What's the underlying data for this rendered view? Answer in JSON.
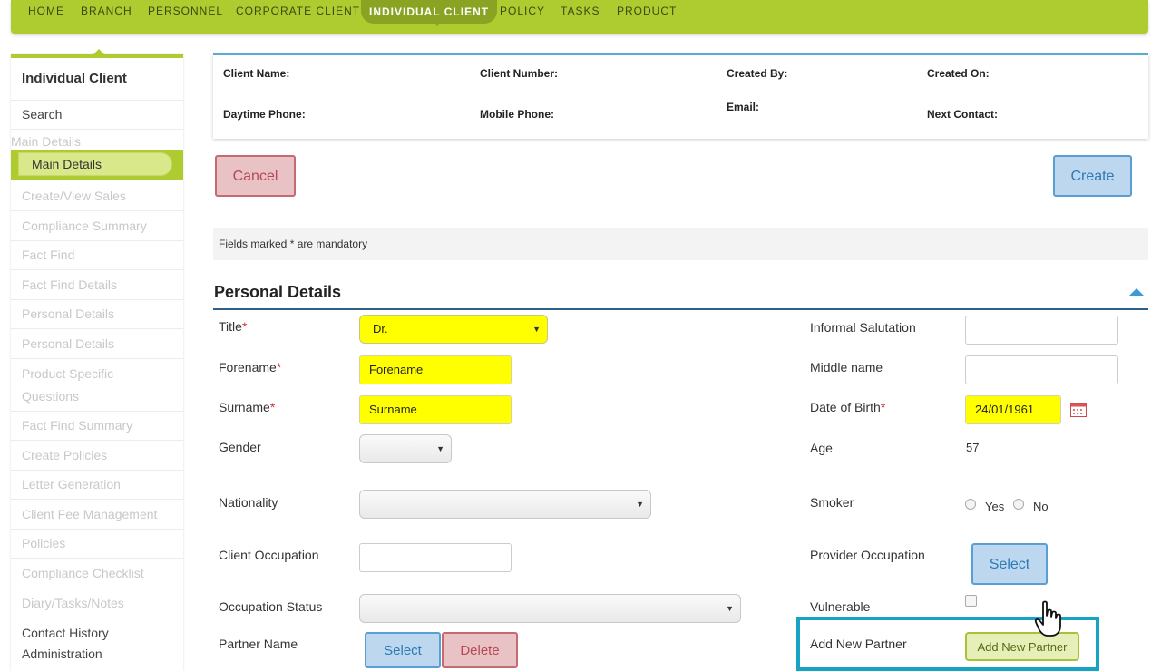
{
  "nav": {
    "items": [
      "HOME",
      "BRANCH",
      "PERSONNEL",
      "CORPORATE CLIENT",
      "INDIVIDUAL CLIENT",
      "POLICY",
      "TASKS",
      "PRODUCT"
    ],
    "active": "INDIVIDUAL CLIENT",
    "accent": "#aecb2f"
  },
  "sidebar": {
    "title": "Individual Client",
    "search": "Search",
    "section": "Main Details",
    "active_item": "Main Details",
    "items": [
      "Create/View Sales",
      "Compliance Summary",
      "Fact Find",
      "Fact Find Details",
      "Personal Details",
      "Personal Details",
      "Product Specific",
      "Questions",
      "Fact Find Summary",
      "Create Policies",
      "Letter Generation",
      "Client Fee Management",
      "Policies",
      "Compliance Checklist",
      "Diary/Tasks/Notes"
    ],
    "contact_history": "Contact History",
    "administration": "Administration"
  },
  "client_card": {
    "client_name": "Client Name:",
    "client_number": "Client Number:",
    "created_by": "Created By:",
    "created_on": "Created On:",
    "daytime_phone": "Daytime Phone:",
    "mobile_phone": "Mobile Phone:",
    "email": "Email:",
    "next_contact": "Next Contact:"
  },
  "actions": {
    "cancel": "Cancel",
    "create": "Create"
  },
  "notice": "Fields marked * are mandatory",
  "section_title": "Personal Details",
  "form": {
    "title_label": "Title",
    "title_value": "Dr.",
    "forename_label": "Forename",
    "forename_value": "Forename",
    "surname_label": "Surname",
    "surname_value": "Surname",
    "gender_label": "Gender",
    "nationality_label": "Nationality",
    "client_occupation_label": "Client Occupation",
    "occupation_status_label": "Occupation Status",
    "partner_name_label": "Partner Name",
    "partner_select": "Select",
    "partner_delete": "Delete",
    "informal_salutation_label": "Informal Salutation",
    "middle_name_label": "Middle name",
    "dob_label": "Date of Birth",
    "dob_value": "24/01/1961",
    "age_label": "Age",
    "age_value": "57",
    "smoker_label": "Smoker",
    "smoker_yes": "Yes",
    "smoker_no": "No",
    "provider_occupation_label": "Provider Occupation",
    "provider_select": "Select",
    "vulnerable_label": "Vulnerable",
    "add_new_partner_label": "Add New Partner",
    "add_new_partner_button": "Add New Partner",
    "required_mark": "*"
  },
  "icons": [
    "calendar-icon",
    "hand-cursor-icon",
    "collapse-up-icon",
    "dropdown-arrow-icon"
  ]
}
